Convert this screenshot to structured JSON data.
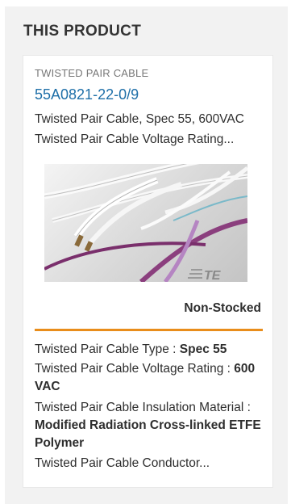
{
  "section": {
    "title": "THIS PRODUCT"
  },
  "product": {
    "category": "TWISTED PAIR CABLE",
    "part_number": "55A0821-22-0/9",
    "description_line1": "Twisted Pair Cable, Spec 55, 600VAC",
    "description_line2": "Twisted Pair Cable Voltage Rating...",
    "image_logo_text": "TE",
    "stock_status": "Non-Stocked",
    "specs": [
      {
        "label": "Twisted Pair Cable Type : ",
        "value": "Spec 55"
      },
      {
        "label": "Twisted Pair Cable Voltage Rating : ",
        "value": "600 VAC"
      },
      {
        "label": "Twisted Pair Cable Insulation Material : ",
        "value": "Modified Radiation Cross-linked ETFE Polymer"
      },
      {
        "label": "Twisted Pair Cable Conductor...",
        "value": ""
      }
    ]
  },
  "colors": {
    "link": "#1e6fa8",
    "accent_divider": "#e98d1b",
    "panel_background": "#f2f2f2"
  }
}
